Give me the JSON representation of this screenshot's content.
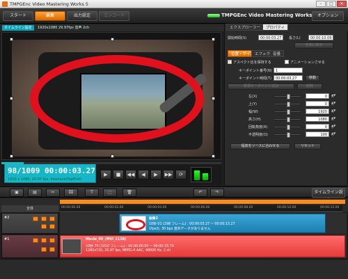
{
  "window": {
    "title": "TMPGEnc Video Mastering Works 5",
    "minimize": "–",
    "maximize": "□",
    "close": "✕"
  },
  "topbar": {
    "tabs": [
      {
        "label": "スタート",
        "state": "normal"
      },
      {
        "label": "編集",
        "state": "active"
      },
      {
        "label": "出力設定",
        "state": "normal"
      },
      {
        "label": "エンコード",
        "state": "disabled"
      }
    ],
    "brand": "TMPGEnc Video Mastering Works 5",
    "option_label": "オプション"
  },
  "subbar": {
    "timeline_badge": "タイムライン設定",
    "info": "1920x1080 29.97fps 音声 2ch"
  },
  "status": {
    "timecode": "98/1009  00:00:03.27",
    "meta": "1920 x 1080,  29.97 fps,  Interlace(TopFirst)",
    "progress": 0.1
  },
  "panel": {
    "tabs": [
      "エクスプローラー",
      "プロパティ"
    ],
    "start_label": "開始時間(S)",
    "start_value": "00:00:03.27",
    "length_label": "長さ(L)",
    "length_value": "00:00:10.09",
    "reset_button": "全体に表示",
    "subtabs": [
      "位置・サイズ",
      "エフェクト",
      "音量"
    ],
    "aspect_label": "アスペクト比を保持する",
    "animation_label": "アニメーションさせる",
    "keypoint_no_label": "キーポイント番号(N)",
    "keypoint_no_value": "1",
    "keypoint_time_label": "キーポイント時間(T)",
    "keypoint_time_value": "00:00:03.27",
    "move_button": "移動",
    "new_keypoint_button": "新規キーポイント追加",
    "delete_button": "削除",
    "params": [
      {
        "label": "左(X)",
        "value": "0"
      },
      {
        "label": "上(Y)",
        "value": "0"
      },
      {
        "label": "幅(W)",
        "value": "1920"
      },
      {
        "label": "高さ(H)",
        "value": "1080"
      },
      {
        "label": "回転角度(R)",
        "value": "0"
      },
      {
        "label": "不透明度(O)",
        "value": "100"
      }
    ],
    "fit_button": "幅高をソースに合わせる",
    "reset2_button": "リセット"
  },
  "toolbar2": {
    "timeline_settings": "タイムライン設定"
  },
  "ruler": {
    "header": "全体",
    "ticks": [
      "00:00:00.00",
      "00:00:02.00",
      "00:00:04.00",
      "00:00:06.00",
      "00:00:08.00",
      "00:00:10.00",
      "00:00:12.00"
    ]
  },
  "tracks": [
    {
      "label": "#2",
      "clip_name": "画像2",
      "clip_line1": "10秒 01 (298 フレーム) : 00:00:03.27 ~ 00:00:13.27",
      "clip_line2": "1fpsの, 30 bps  音声データがありません"
    },
    {
      "label": "#1",
      "clip_name": "Movie_09_(MVI_1138)",
      "clip_line1": "10秒 70 (1010 フレーム) : 00:00:00.00 ~ 00:00:33.70",
      "clip_line2": "1280x720, 29.97 fps, MPEG-4 AAC, 48000 Hz, 2 ch"
    }
  ]
}
